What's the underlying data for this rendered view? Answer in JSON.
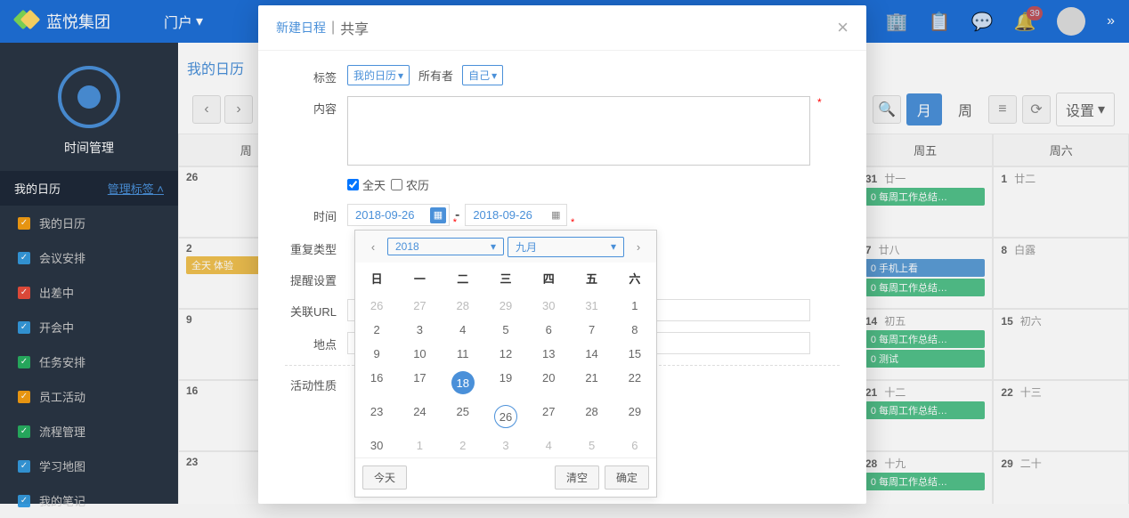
{
  "topbar": {
    "brand": "蓝悦集团",
    "portal": "门户",
    "badge": "39"
  },
  "sidebar": {
    "clock_label": "时间管理",
    "header": "我的日历",
    "manage_link": "管理标签",
    "items": [
      {
        "label": "我的日历",
        "color": "orange"
      },
      {
        "label": "会议安排",
        "color": "blue"
      },
      {
        "label": "出差中",
        "color": "red"
      },
      {
        "label": "开会中",
        "color": "blue"
      },
      {
        "label": "任务安排",
        "color": "green"
      },
      {
        "label": "员工活动",
        "color": "orange"
      },
      {
        "label": "流程管理",
        "color": "green"
      },
      {
        "label": "学习地图",
        "color": "blue"
      },
      {
        "label": "我的笔记",
        "color": "blue"
      }
    ]
  },
  "content": {
    "breadcrumb": "我的日历",
    "views": {
      "month": "月",
      "week": "周",
      "settings": "设置"
    },
    "dow": [
      "周",
      "",
      "",
      "",
      "",
      "周五",
      "周六"
    ],
    "cells": [
      {
        "d": "26",
        "events": []
      },
      {
        "d": "",
        "events": []
      },
      {
        "d": "",
        "events": []
      },
      {
        "d": "",
        "events": []
      },
      {
        "d": "",
        "events": []
      },
      {
        "d": "31",
        "l": "廿一",
        "events": [
          {
            "t": "0 每周工作总结…",
            "c": "green"
          }
        ]
      },
      {
        "d": "1",
        "l": "廿二",
        "events": []
      },
      {
        "d": "2",
        "events": [
          {
            "t": "全天 体验",
            "c": "orange"
          }
        ]
      },
      {
        "d": "",
        "events": []
      },
      {
        "d": "",
        "events": []
      },
      {
        "d": "",
        "events": []
      },
      {
        "d": "",
        "events": []
      },
      {
        "d": "7",
        "l": "廿八",
        "events": [
          {
            "t": "0 手机上看",
            "c": "blue"
          },
          {
            "t": "0 每周工作总结…",
            "c": "green"
          }
        ]
      },
      {
        "d": "8",
        "l": "白露",
        "events": []
      },
      {
        "d": "9",
        "events": []
      },
      {
        "d": "",
        "events": []
      },
      {
        "d": "",
        "events": []
      },
      {
        "d": "",
        "events": []
      },
      {
        "d": "",
        "events": []
      },
      {
        "d": "14",
        "l": "初五",
        "events": [
          {
            "t": "0 每周工作总结…",
            "c": "green"
          },
          {
            "t": "0 测试",
            "c": "green"
          }
        ]
      },
      {
        "d": "15",
        "l": "初六",
        "events": []
      },
      {
        "d": "16",
        "events": []
      },
      {
        "d": "",
        "events": []
      },
      {
        "d": "",
        "events": []
      },
      {
        "d": "",
        "events": []
      },
      {
        "d": "",
        "events": []
      },
      {
        "d": "21",
        "l": "十二",
        "events": [
          {
            "t": "0 每周工作总结…",
            "c": "green"
          }
        ]
      },
      {
        "d": "22",
        "l": "十三",
        "events": []
      },
      {
        "d": "23",
        "events": []
      },
      {
        "d": "",
        "events": []
      },
      {
        "d": "",
        "events": []
      },
      {
        "d": "",
        "events": []
      },
      {
        "d": "",
        "events": []
      },
      {
        "d": "28",
        "l": "十九",
        "events": [
          {
            "t": "0 每周工作总结…",
            "c": "green"
          }
        ]
      },
      {
        "d": "29",
        "l": "二十",
        "events": []
      }
    ]
  },
  "modal": {
    "tab1": "新建日程",
    "tab2": "共享",
    "labels": {
      "tag": "标签",
      "content": "内容",
      "time": "时间",
      "repeat": "重复类型",
      "remind": "提醒设置",
      "url": "关联URL",
      "location": "地点",
      "nature": "活动性质"
    },
    "tag_select": "我的日历",
    "owner_text": "所有者",
    "owner_select": "自己",
    "allday": "全天",
    "lunar": "农历",
    "date1": "2018-09-26",
    "date2": "2018-09-26",
    "dash": "-"
  },
  "dp": {
    "year": "2018",
    "month": "九月",
    "dow": [
      "日",
      "一",
      "二",
      "三",
      "四",
      "五",
      "六"
    ],
    "rows": [
      [
        {
          "n": "26",
          "m": 1
        },
        {
          "n": "27",
          "m": 1
        },
        {
          "n": "28",
          "m": 1
        },
        {
          "n": "29",
          "m": 1
        },
        {
          "n": "30",
          "m": 1
        },
        {
          "n": "31",
          "m": 1
        },
        {
          "n": "1"
        }
      ],
      [
        {
          "n": "2"
        },
        {
          "n": "3"
        },
        {
          "n": "4"
        },
        {
          "n": "5"
        },
        {
          "n": "6"
        },
        {
          "n": "7"
        },
        {
          "n": "8"
        }
      ],
      [
        {
          "n": "9"
        },
        {
          "n": "10"
        },
        {
          "n": "11"
        },
        {
          "n": "12"
        },
        {
          "n": "13"
        },
        {
          "n": "14"
        },
        {
          "n": "15"
        }
      ],
      [
        {
          "n": "16"
        },
        {
          "n": "17"
        },
        {
          "n": "18",
          "today": 1
        },
        {
          "n": "19"
        },
        {
          "n": "20"
        },
        {
          "n": "21"
        },
        {
          "n": "22"
        }
      ],
      [
        {
          "n": "23"
        },
        {
          "n": "24"
        },
        {
          "n": "25"
        },
        {
          "n": "26",
          "sel": 1
        },
        {
          "n": "27"
        },
        {
          "n": "28"
        },
        {
          "n": "29"
        }
      ],
      [
        {
          "n": "30"
        },
        {
          "n": "1",
          "m": 1
        },
        {
          "n": "2",
          "m": 1
        },
        {
          "n": "3",
          "m": 1
        },
        {
          "n": "4",
          "m": 1
        },
        {
          "n": "5",
          "m": 1
        },
        {
          "n": "6",
          "m": 1
        }
      ]
    ],
    "today": "今天",
    "clear": "清空",
    "ok": "确定"
  }
}
